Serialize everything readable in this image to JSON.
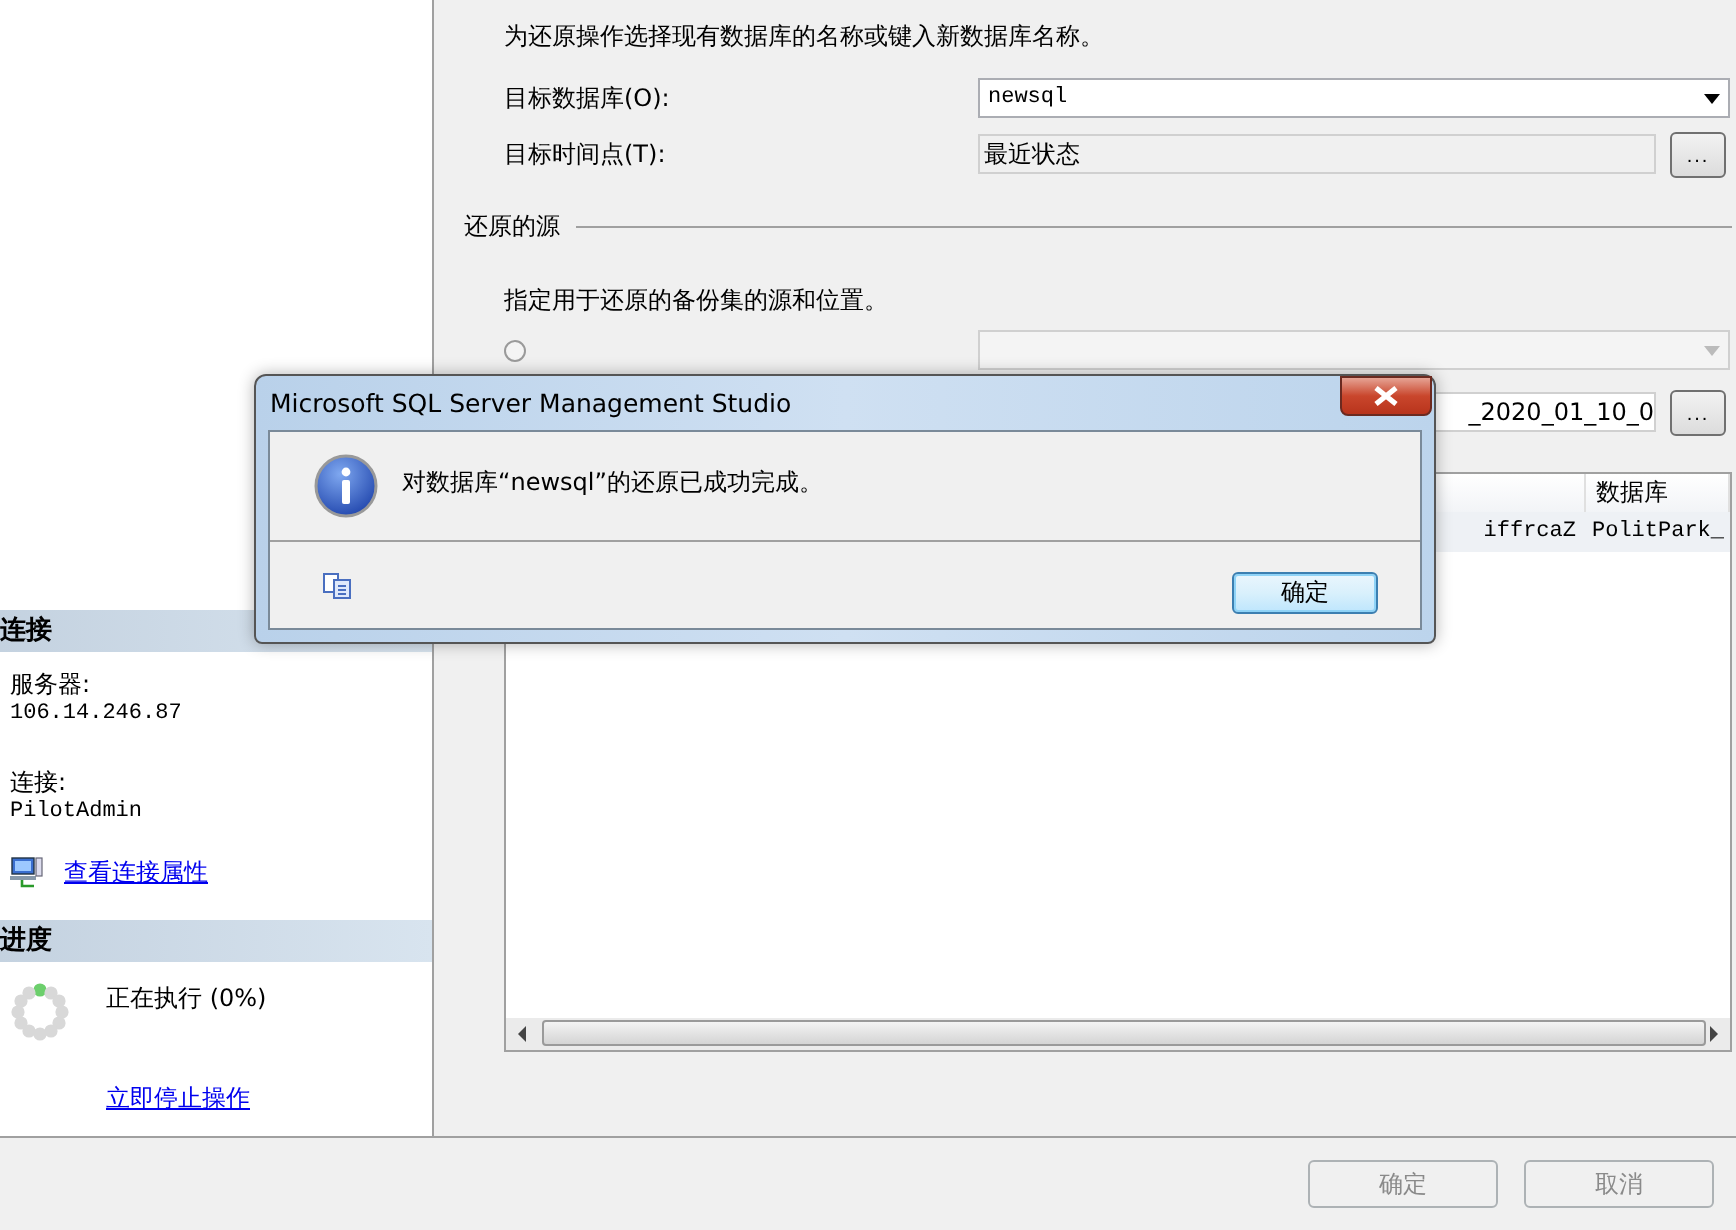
{
  "connection": {
    "title": "连接",
    "server_label": "服务器:",
    "server": "106.14.246.87",
    "login_label": "连接:",
    "login": "PilotAdmin",
    "link": "查看连接属性"
  },
  "progress": {
    "title": "进度",
    "status": "正在执行 (0%)",
    "stop_link": "立即停止操作"
  },
  "destination": {
    "intro": "为还原操作选择现有数据库的名称或键入新数据库名称。",
    "fields": [
      {
        "label": "目标数据库(O):",
        "value": "newsql",
        "kind": "dropdown"
      },
      {
        "label": "目标时间点(T):",
        "value": "最近状态",
        "kind": "browse",
        "button": "..."
      }
    ]
  },
  "source": {
    "title": "还原的源",
    "intro": "指定用于还原的备份集的源和位置。",
    "database_option": {
      "selected": false,
      "disabled": true
    },
    "device_value": "_2020_01_10_0",
    "device_button": "..."
  },
  "backup_table": {
    "columns": [
      "",
      "数据库"
    ],
    "rows": [
      [
        "iffrcaZ",
        "PolitPark_"
      ]
    ]
  },
  "footer": {
    "buttons": [
      {
        "label": "确定",
        "disabled": true
      },
      {
        "label": "取消",
        "disabled": true
      }
    ]
  },
  "dialog": {
    "title": "Microsoft SQL Server Management Studio",
    "message": "对数据库“newsql”的还原已成功完成。",
    "button": "确定"
  }
}
